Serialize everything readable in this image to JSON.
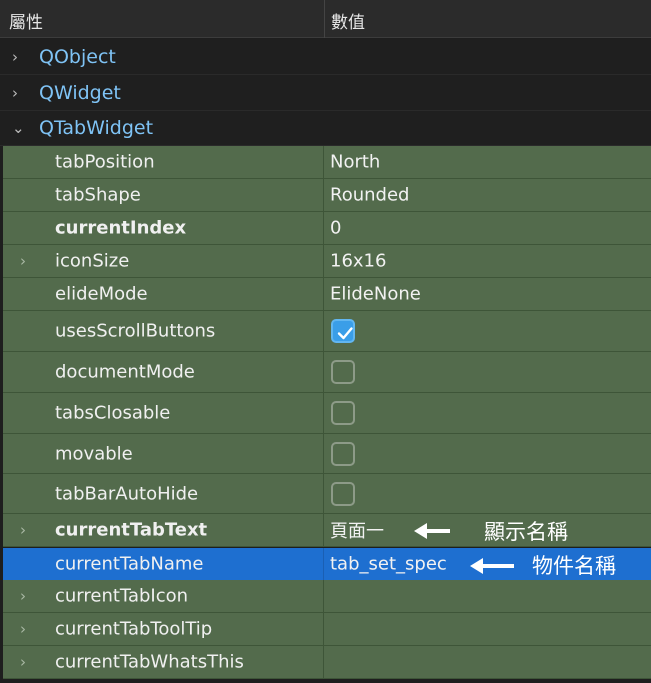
{
  "header": {
    "property_label": "屬性",
    "value_label": "數值"
  },
  "groups": [
    {
      "name": "QObject",
      "expanded": false
    },
    {
      "name": "QWidget",
      "expanded": false
    },
    {
      "name": "QTabWidget",
      "expanded": true
    }
  ],
  "properties": [
    {
      "name": "tabPosition",
      "value": "North"
    },
    {
      "name": "tabShape",
      "value": "Rounded"
    },
    {
      "name": "currentIndex",
      "value": "0"
    },
    {
      "name": "iconSize",
      "value": "16x16"
    },
    {
      "name": "elideMode",
      "value": "ElideNone"
    },
    {
      "name": "usesScrollButtons",
      "checked": true
    },
    {
      "name": "documentMode",
      "checked": false
    },
    {
      "name": "tabsClosable",
      "checked": false
    },
    {
      "name": "movable",
      "checked": false
    },
    {
      "name": "tabBarAutoHide",
      "checked": false
    },
    {
      "name": "currentTabText",
      "value": "頁面一"
    },
    {
      "name": "currentTabName",
      "value": "tab_set_spec"
    },
    {
      "name": "currentTabIcon",
      "value": ""
    },
    {
      "name": "currentTabToolTip",
      "value": ""
    },
    {
      "name": "currentTabWhatsThis",
      "value": ""
    }
  ],
  "annotations": {
    "display_name": "顯示名稱",
    "object_name": "物件名稱"
  },
  "colors": {
    "selection": "#1e6fd0",
    "property_bg": "#536b4c",
    "group_text": "#7fc3f5",
    "checkbox_on": "#3a9ee8"
  },
  "icons": [
    "chevron-right-icon",
    "chevron-down-icon",
    "checkmark-icon",
    "arrow-left-icon"
  ]
}
